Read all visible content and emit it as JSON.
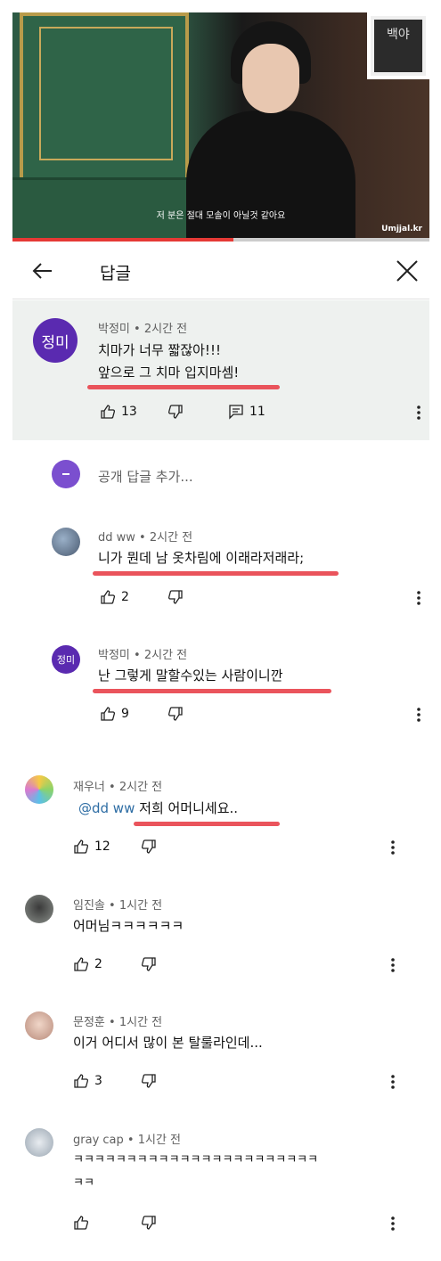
{
  "video": {
    "subtitle": "저 분은 절대 모솔이 아닐것 같아요",
    "watermark": "Umjjal.kr",
    "frame_text": "백야",
    "progress_fraction": 0.53
  },
  "header": {
    "title": "답글"
  },
  "pinned": {
    "avatar_text": "정미",
    "author": "박정미",
    "time": "2시간 전",
    "line1": "치마가 너무 짧잖아!!!",
    "line2": "앞으로 그 치마 입지마셈!",
    "likes": "13",
    "replies": "11"
  },
  "add_reply": {
    "placeholder": "공개 답글 추가..."
  },
  "replies": [
    {
      "author": "dd ww",
      "time": "2시간 전",
      "text": "니가 뭔데 남 옷차림에 이래라저래라;",
      "likes": "2"
    },
    {
      "author": "박정미",
      "time": "2시간 전",
      "text": "난 그렇게 말할수있는 사람이니깐",
      "likes": "9",
      "avatar_text": "정미"
    },
    {
      "author": "재우너",
      "time": "2시간 전",
      "mention": "@dd ww",
      "text": "저희 어머니세요..",
      "likes": "12"
    },
    {
      "author": "임진솔",
      "time": "1시간 전",
      "text": "어머님ㅋㅋㅋㅋㅋㅋ",
      "likes": "2"
    },
    {
      "author": "문정훈",
      "time": "1시간 전",
      "text": "이거 어디서 많이 본 탈룰라인데...",
      "likes": "3"
    },
    {
      "author": "gray cap",
      "time": "1시간 전",
      "text": "ㅋㅋㅋㅋㅋㅋㅋㅋㅋㅋㅋㅋㅋㅋㅋㅋㅋㅋㅋㅋㅋㅋㅋ",
      "text2": "ㅋㅋ",
      "likes": ""
    }
  ],
  "colors": {
    "accent_red": "#e8414a",
    "avatar_purple": "#5a2ab0",
    "mention_blue": "#2e6da4"
  },
  "meta_sep": "•"
}
